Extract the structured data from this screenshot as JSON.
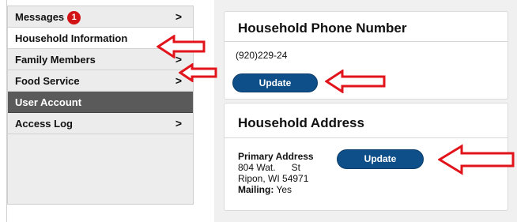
{
  "sidebar": {
    "items": [
      {
        "label": "Messages",
        "badge": "1",
        "chevron": ">"
      },
      {
        "label": "Household Information"
      },
      {
        "label": "Family Members",
        "chevron": ">"
      },
      {
        "label": "Food Service",
        "chevron": ">"
      },
      {
        "label": "User Account"
      },
      {
        "label": "Access Log",
        "chevron": ">"
      }
    ]
  },
  "phone_card": {
    "title": "Household Phone Number",
    "phone": "(920)229-24",
    "button": "Update"
  },
  "address_card": {
    "title": "Household Address",
    "address_label": "Primary Address",
    "street": "804 Wat.      St",
    "city": "Ripon, WI 54971",
    "mailing_label": "Mailing:",
    "mailing_value": "Yes",
    "button": "Update"
  },
  "colors": {
    "button": "#0f4f89",
    "arrow": "#e0141a",
    "badge": "#d21416",
    "selected_dark": "#5a5a5a"
  }
}
